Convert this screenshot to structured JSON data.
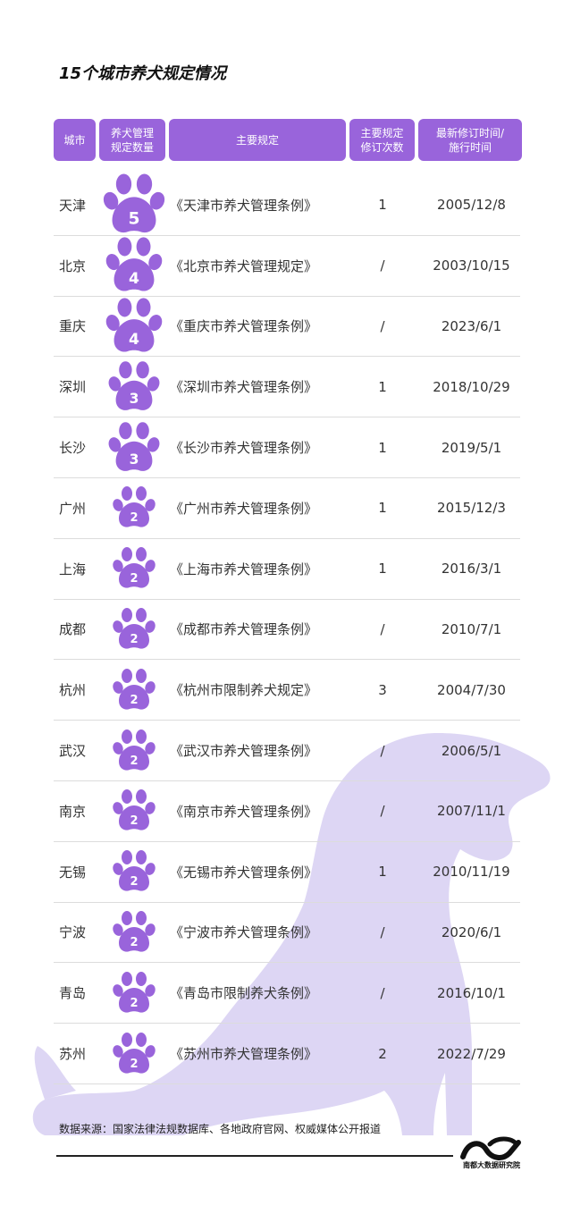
{
  "title": "15个城市养犬规定情况",
  "headers": {
    "city": "城市",
    "count": "养犬管理\n规定数量",
    "regulation": "主要规定",
    "revisions": "主要规定\n修订次数",
    "latest": "最新修订时间/\n施行时间"
  },
  "rows": [
    {
      "city": "天津",
      "count": 5,
      "count_label": "5",
      "regulation": "《天津市养犬管理条例》",
      "revisions": "1",
      "date": "2005/12/8"
    },
    {
      "city": "北京",
      "count": 4,
      "count_label": "4",
      "regulation": "《北京市养犬管理规定》",
      "revisions": "/",
      "date": "2003/10/15"
    },
    {
      "city": "重庆",
      "count": 4,
      "count_label": "4",
      "regulation": "《重庆市养犬管理条例》",
      "revisions": "/",
      "date": "2023/6/1"
    },
    {
      "city": "深圳",
      "count": 3,
      "count_label": "3",
      "regulation": "《深圳市养犬管理条例》",
      "revisions": "1",
      "date": "2018/10/29"
    },
    {
      "city": "长沙",
      "count": 3,
      "count_label": "3",
      "regulation": "《长沙市养犬管理条例》",
      "revisions": "1",
      "date": "2019/5/1"
    },
    {
      "city": "广州",
      "count": 2,
      "count_label": "2",
      "regulation": "《广州市养犬管理条例》",
      "revisions": "1",
      "date": "2015/12/3"
    },
    {
      "city": "上海",
      "count": 2,
      "count_label": "2",
      "regulation": "《上海市养犬管理条例》",
      "revisions": "1",
      "date": "2016/3/1"
    },
    {
      "city": "成都",
      "count": 2,
      "count_label": "2",
      "regulation": "《成都市养犬管理条例》",
      "revisions": "/",
      "date": "2010/7/1"
    },
    {
      "city": "杭州",
      "count": 2,
      "count_label": "2",
      "regulation": "《杭州市限制养犬规定》",
      "revisions": "3",
      "date": "2004/7/30"
    },
    {
      "city": "武汉",
      "count": 2,
      "count_label": "2",
      "regulation": "《武汉市养犬管理条例》",
      "revisions": "/",
      "date": "2006/5/1"
    },
    {
      "city": "南京",
      "count": 2,
      "count_label": "2",
      "regulation": "《南京市养犬管理条例》",
      "revisions": "/",
      "date": "2007/11/1"
    },
    {
      "city": "无锡",
      "count": 2,
      "count_label": "2",
      "regulation": "《无锡市养犬管理条例》",
      "revisions": "1",
      "date": "2010/11/19"
    },
    {
      "city": "宁波",
      "count": 2,
      "count_label": "2",
      "regulation": "《宁波市养犬管理条例》",
      "revisions": "/",
      "date": "2020/6/1"
    },
    {
      "city": "青岛",
      "count": 2,
      "count_label": "2",
      "regulation": "《青岛市限制养犬条例》",
      "revisions": "/",
      "date": "2016/10/1"
    },
    {
      "city": "苏州",
      "count": 2,
      "count_label": "2",
      "regulation": "《苏州市养犬管理条例》",
      "revisions": "2",
      "date": "2022/7/29"
    }
  ],
  "source": "数据来源：国家法律法规数据库、各地政府官网、权威媒体公开报道",
  "logo_text": "南都大数据研究院",
  "colors": {
    "header_bg": "#9964db",
    "paw": "#9964db",
    "dog": "#ddd6f4"
  },
  "icons": {
    "paw": "paw-icon",
    "dog": "dog-silhouette",
    "logo": "nandu-logo"
  }
}
